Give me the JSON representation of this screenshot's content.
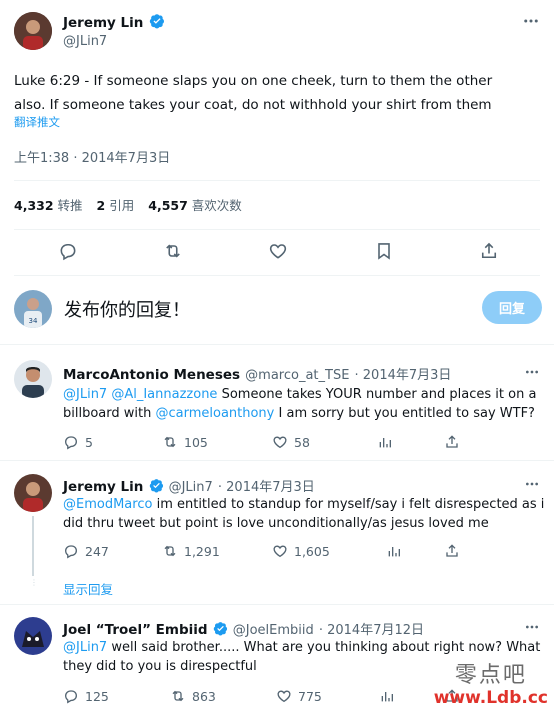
{
  "main_tweet": {
    "author_name": "Jeremy Lin",
    "author_handle": "@JLin7",
    "text_line1": "Luke 6:29 - If someone slaps you on one cheek, turn to them the other",
    "text_line2": "also. If someone takes your coat, do not withhold your shirt from them",
    "translate_label": "翻译推文",
    "timestamp": "上午1:38 · 2014年7月3日",
    "stats": {
      "retweets_count": "4,332",
      "retweets_label": "转推",
      "quotes_count": "2",
      "quotes_label": "引用",
      "likes_count": "4,557",
      "likes_label": "喜欢次数"
    }
  },
  "compose": {
    "placeholder": "发布你的回复！",
    "reply_button": "回复"
  },
  "replies": [
    {
      "name": "MarcoAntonio Meneses",
      "handle": "@marco_at_TSE",
      "date": "· 2014年7月3日",
      "mention1": "@JLin7",
      "mention2": "@Al_Iannazzone",
      "text_a": "Someone takes YOUR number and places it on a",
      "text_b": "billboard with",
      "mention3": "@carmeloanthony",
      "text_c": "I am sorry but you entitled to say WTF?",
      "replies": "5",
      "retweets": "105",
      "likes": "58"
    },
    {
      "name": "Jeremy Lin",
      "handle": "@JLin7",
      "date": "· 2014年7月3日",
      "mention1": "@EmodMarco",
      "text_a": "im entitled to standup for myself/say i felt disrespected as i",
      "text_b": "did thru tweet but point is love unconditionally/as jesus loved me",
      "replies": "247",
      "retweets": "1,291",
      "likes": "1,605"
    },
    {
      "name": "Joel “Troel” Embiid",
      "handle": "@JoelEmbiid",
      "date": "· 2014年7月12日",
      "mention1": "@JLin7",
      "text_a": "well said brother..... What are you thinking about right now? What",
      "text_b": "they did to you is direspectful",
      "replies": "125",
      "retweets": "863",
      "likes": "775"
    }
  ],
  "show_replies": "显示回复",
  "watermark": {
    "line1": "零点吧",
    "line2": "www.Ldb.cc"
  },
  "colors": {
    "accent": "#1d9bf0",
    "accent_disabled": "#8ecdf8",
    "verified": "#1d9bf0",
    "text_secondary": "#536471",
    "divider": "#eff3f4"
  }
}
